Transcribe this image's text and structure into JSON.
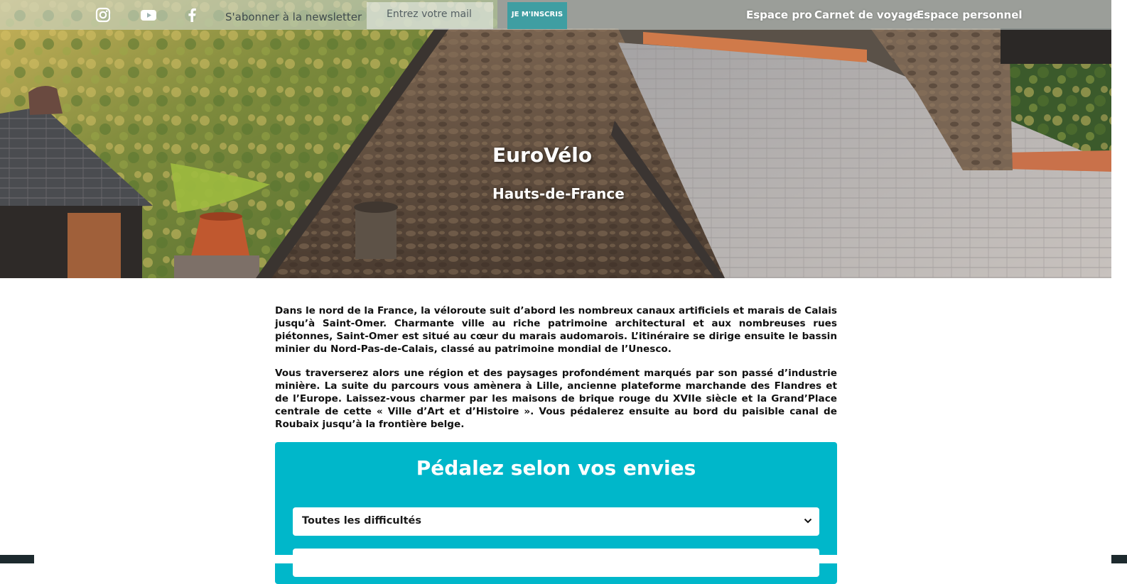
{
  "header": {
    "social": [
      "instagram-icon",
      "youtube-icon",
      "facebook-icon"
    ],
    "newsletter_label": "S'abonner à la newsletter",
    "email_placeholder": "Entrez votre mail",
    "subscribe_label": "JE M'INSCRIS",
    "nav": [
      "Espace pro",
      "Carnet de voyage",
      "Espace personnel"
    ]
  },
  "hero": {
    "title": "EuroVélo",
    "subtitle": "Hauts-de-France"
  },
  "intro": {
    "paragraphs": [
      "Dans le nord de la France, la véloroute suit d’abord les nombreux canaux artificiels et marais de Calais jusqu’à Saint-Omer. Charmante ville au riche patrimoine architectural et aux nombreuses rues piétonnes, Saint-Omer est situé au cœur du marais audomarois. L’itinéraire se dirige ensuite le bassin minier du Nord-Pas-de-Calais, classé au patrimoine mondial de l’Unesco.",
      "Vous traverserez alors une région et des paysages profondément marqués par son passé d’industrie minière. La suite du parcours vous amènera à Lille, ancienne plateforme marchande des Flandres et de l’Europe. Laissez-vous charmer par les maisons de brique rouge du XVIIe siècle et la Grand’Place centrale de cette « Ville d’Art et d’Histoire ». Vous pédalerez ensuite au bord du paisible canal de Roubaix jusqu’à la frontière belge."
    ]
  },
  "filters": {
    "title": "Pédalez selon vos envies",
    "difficulty_selected": "Toutes les difficultés",
    "second_selected": ""
  },
  "colors": {
    "accent": "#00b7ca",
    "subscribe_button": "#3f9ea2"
  }
}
